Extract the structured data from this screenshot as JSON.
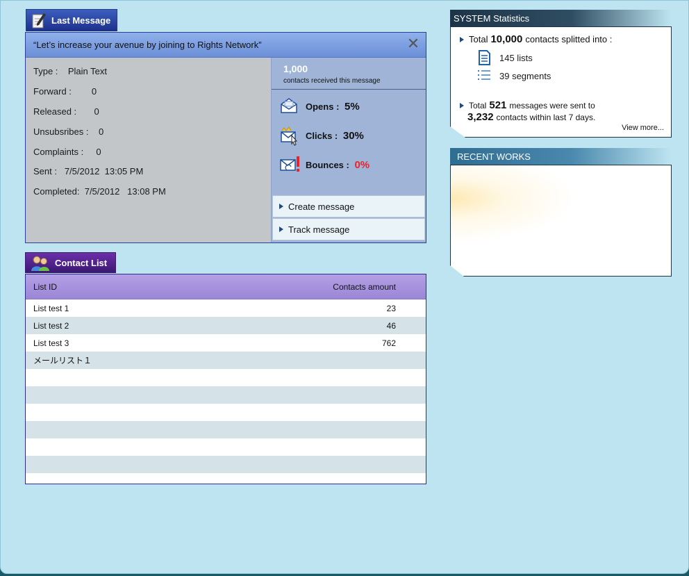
{
  "last_message": {
    "tab_label": "Last Message",
    "subject": "“Let’s increase your avenue by joining to Rights Network”",
    "details": [
      {
        "label": "Type :",
        "value": "Plain Text"
      },
      {
        "label": "Forward :",
        "value": "0"
      },
      {
        "label": "Released :",
        "value": "0"
      },
      {
        "label": "Unsubsribes :",
        "value": "0"
      },
      {
        "label": "Complaints :",
        "value": "0"
      },
      {
        "label": "Sent :",
        "value": "7/5/2012  13:05 PM"
      },
      {
        "label": "Completed:",
        "value": "7/5/2012   13:08 PM"
      }
    ],
    "received_count": "1,000",
    "received_label": "contacts received this message",
    "opens_label": "Opens",
    "opens_value": "5%",
    "clicks_label": "Clicks :",
    "clicks_value": "30%",
    "bounces_label": "Bounces :",
    "bounces_value": "0%",
    "create_label": "Create message",
    "track_label": "Track message"
  },
  "contact_list": {
    "tab_label": "Contact List",
    "col_id": "List ID",
    "col_amount": "Contacts amount",
    "rows": [
      {
        "name": "List test 1",
        "amount": "23"
      },
      {
        "name": "List test 2",
        "amount": "46"
      },
      {
        "name": "List test 3",
        "amount": "762"
      },
      {
        "name": "メールリスト１",
        "amount": ""
      },
      {
        "name": "",
        "amount": ""
      },
      {
        "name": "",
        "amount": ""
      },
      {
        "name": "",
        "amount": ""
      },
      {
        "name": "",
        "amount": ""
      },
      {
        "name": "",
        "amount": ""
      },
      {
        "name": "",
        "amount": ""
      },
      {
        "name": "",
        "amount": ""
      }
    ]
  },
  "system_statistics": {
    "title": "SYSTEM Statistics",
    "total_prefix": "Total",
    "total_contacts": "10,000",
    "total_suffix": "contacts splitted into :",
    "lists": "145 lists",
    "segments": "39 segments",
    "msg_prefix": "Total",
    "msg_count": "521",
    "msg_suffix": "messages were sent to",
    "contacts_count": "3,232",
    "contacts_suffix": "contacts within last 7 days.",
    "view_more": "View more..."
  },
  "recent_works": {
    "title": "RECENT WORKS"
  },
  "colors": {
    "page_bg": "#bde4f0",
    "accent_red": "#e8232a",
    "last_message_tab": "#1c2f8a",
    "contact_tab": "#3a1772"
  }
}
